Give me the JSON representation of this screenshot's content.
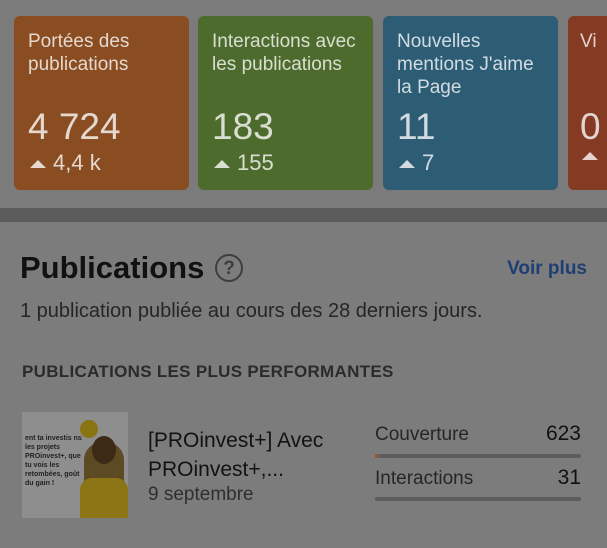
{
  "cards": [
    {
      "label": "Portées des publications",
      "value": "4 724",
      "delta": "4,4 k",
      "color": "#8a4d22"
    },
    {
      "label": "Interactions avec les publications",
      "value": "183",
      "delta": "155",
      "color": "#4d6b2c"
    },
    {
      "label": "Nouvelles mentions J'aime la Page",
      "value": "11",
      "delta": "7",
      "color": "#2d5d75"
    },
    {
      "label": "Vi",
      "value": "0",
      "delta": "",
      "color": "#853a23"
    }
  ],
  "section": {
    "title": "Publications",
    "help": "?",
    "see_more": "Voir plus",
    "subtitle": "1 publication publiée au cours des 28 derniers jours.",
    "top_heading": "PUBLICATIONS LES PLUS PERFORMANTES"
  },
  "post": {
    "title": "[PROinvest+] Avec PROinvest+,...",
    "date": "9 septembre",
    "thumbnail_text": "ent ta investis ns les projets PROinvest+, que tu vois les retombées, goût du gain !",
    "metrics": [
      {
        "label": "Couverture",
        "value": "623",
        "progress": 0.02
      },
      {
        "label": "Interactions",
        "value": "31",
        "progress": 0.0
      }
    ]
  }
}
